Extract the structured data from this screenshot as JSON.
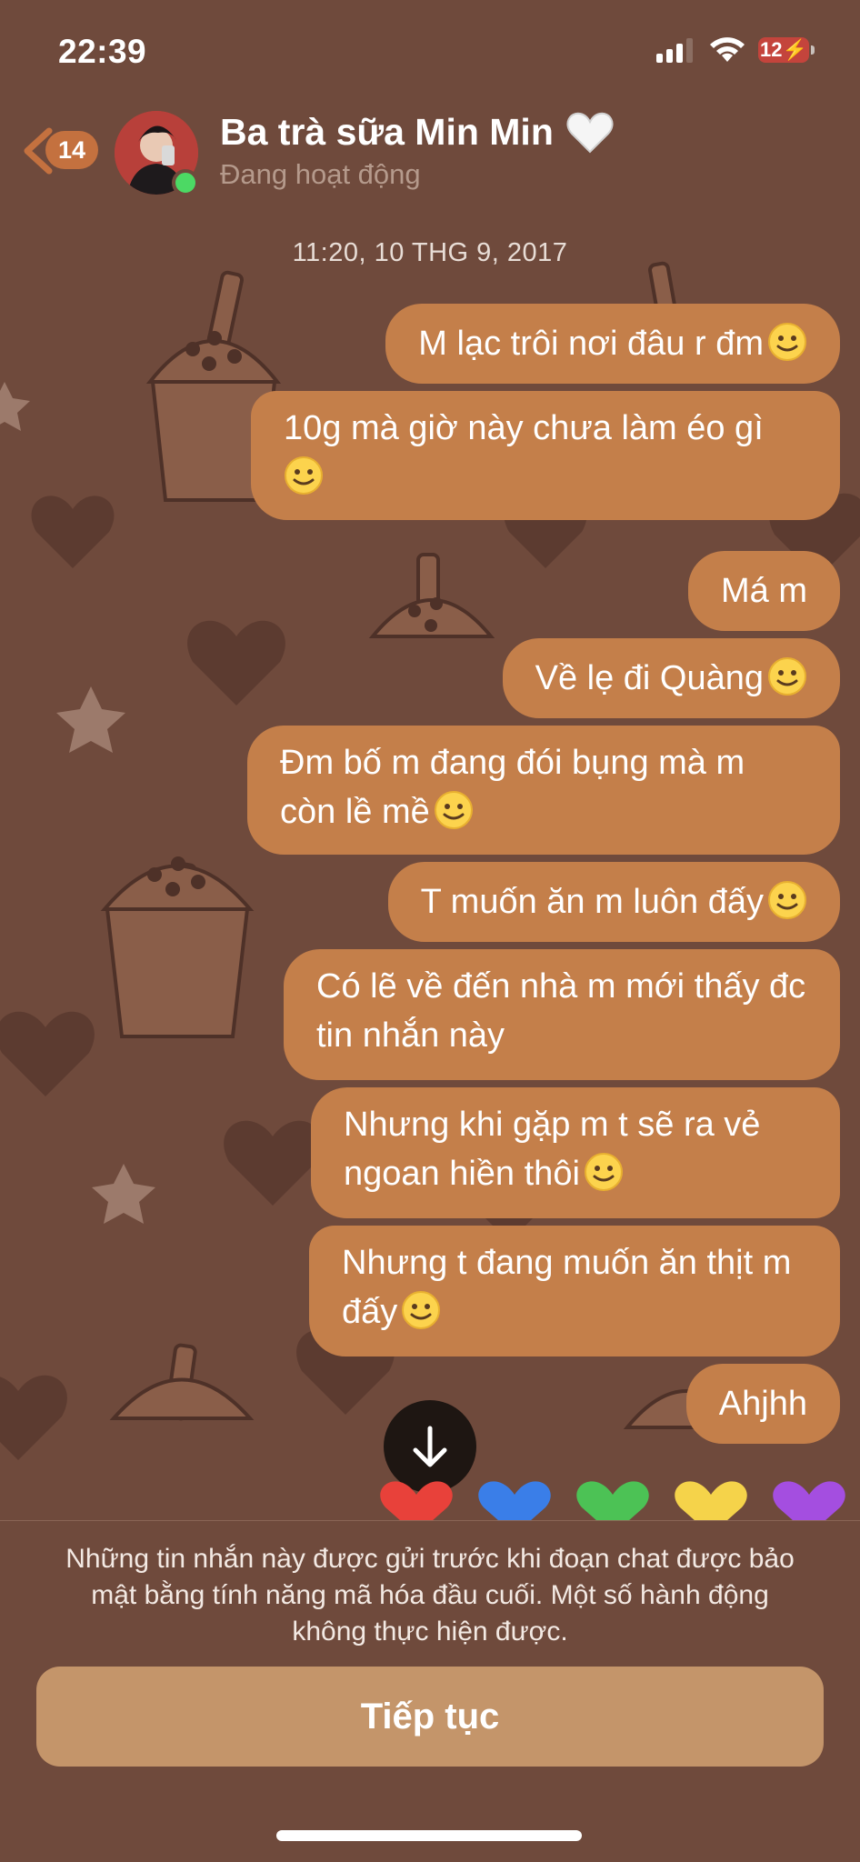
{
  "status_bar": {
    "time": "22:39",
    "battery": "12"
  },
  "header": {
    "back_count": "14",
    "contact_name": "Ba trà sữa Min Min",
    "contact_status": "Đang hoạt động"
  },
  "chat": {
    "timestamp": "11:20, 10 THG 9, 2017",
    "messages": [
      {
        "text": "M lạc trôi nơi đâu r đm",
        "emoji": true
      },
      {
        "text": "10g mà giờ này chưa làm éo gì",
        "emoji": true
      },
      {
        "text": "Má m",
        "emoji": false
      },
      {
        "text": "Về lẹ đi Quàng",
        "emoji": true
      },
      {
        "text": "Đm bố m đang đói bụng mà m còn lề mề",
        "emoji": true
      },
      {
        "text": "T muốn ăn m luôn đấy",
        "emoji": true
      },
      {
        "text": "Có lẽ về đến nhà m mới thấy đc tin nhắn này",
        "emoji": false
      },
      {
        "text": "Nhưng khi gặp m t sẽ ra vẻ ngoan hiền thôi",
        "emoji": true
      },
      {
        "text": "Nhưng t đang muốn ăn thịt m đấy",
        "emoji": true
      },
      {
        "text": "Ahjhh",
        "emoji": false
      }
    ],
    "emoji_icon": "slightly-smiling-face-icon",
    "heart_colors": [
      "#e8413a",
      "#3a7ee8",
      "#4cc255",
      "#f5d34a",
      "#a44ee0"
    ]
  },
  "footer": {
    "notice": "Những tin nhắn này được gửi trước khi đoạn chat được bảo mật bằng tính năng mã hóa đầu cuối. Một số hành động không thực hiện được.",
    "button_label": "Tiếp tục"
  },
  "colors": {
    "background": "#6f4a3c",
    "bubble": "#c47f4a",
    "button": "#c4956a",
    "badge": "#c4713f"
  }
}
